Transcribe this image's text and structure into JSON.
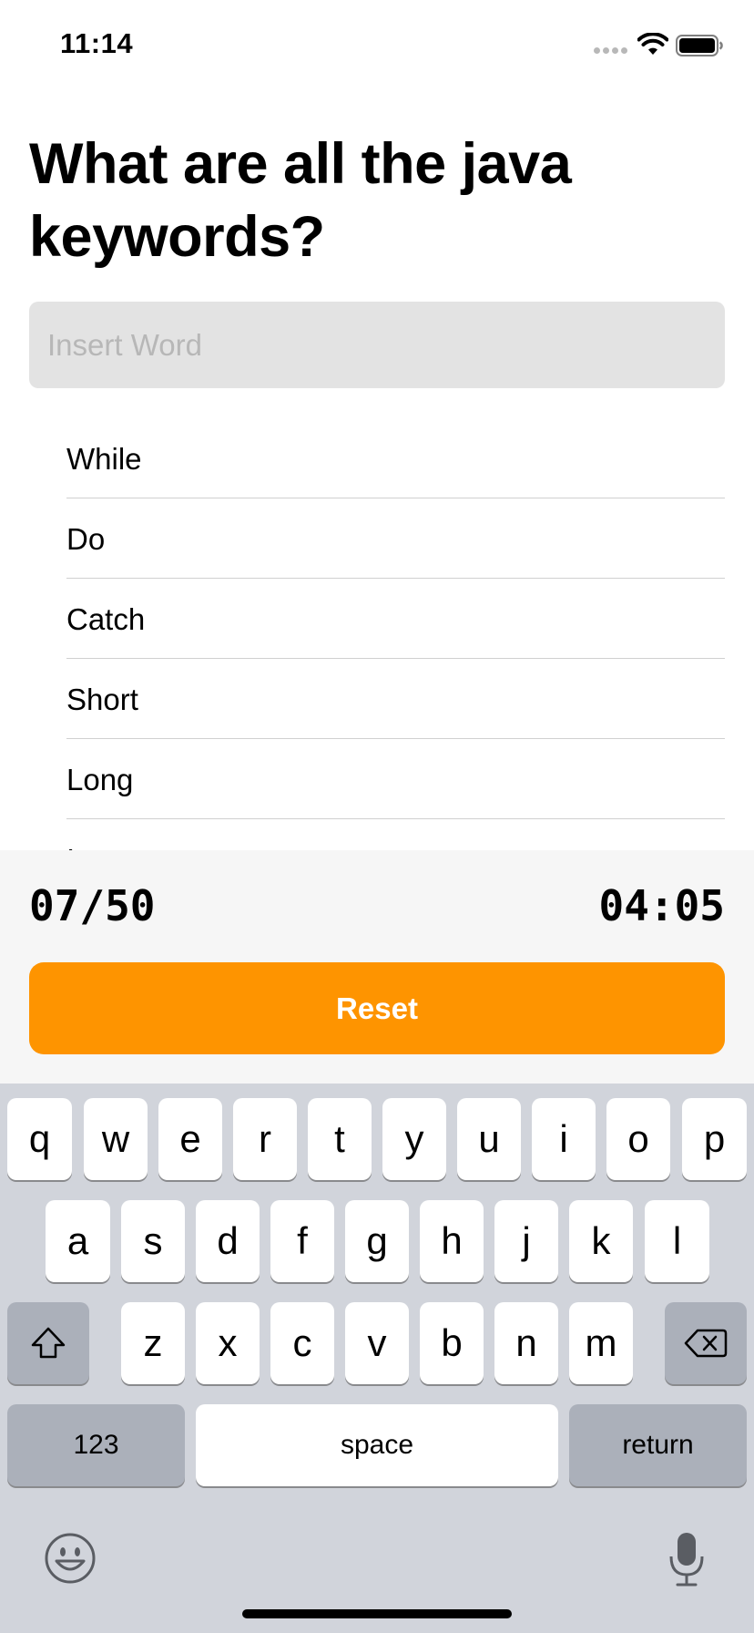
{
  "status_bar": {
    "time": "11:14"
  },
  "question": {
    "title": "What are all the java keywords?"
  },
  "input": {
    "placeholder": "Insert Word",
    "value": ""
  },
  "words": [
    "While",
    "Do",
    "Catch",
    "Short",
    "Long",
    "Int"
  ],
  "footer": {
    "score": "07/50",
    "timer": "04:05",
    "reset_label": "Reset"
  },
  "colors": {
    "accent": "#fe9400",
    "input_bg": "#e3e3e3",
    "panel_bg": "#f6f6f6",
    "keyboard_bg": "#d1d4db"
  },
  "keyboard": {
    "row1": [
      "q",
      "w",
      "e",
      "r",
      "t",
      "y",
      "u",
      "i",
      "o",
      "p"
    ],
    "row2": [
      "a",
      "s",
      "d",
      "f",
      "g",
      "h",
      "j",
      "k",
      "l"
    ],
    "row3": [
      "z",
      "x",
      "c",
      "v",
      "b",
      "n",
      "m"
    ],
    "numbers_label": "123",
    "space_label": "space",
    "return_label": "return",
    "icons": [
      "shift-icon",
      "backspace-icon",
      "emoji-icon",
      "microphone-icon"
    ]
  }
}
